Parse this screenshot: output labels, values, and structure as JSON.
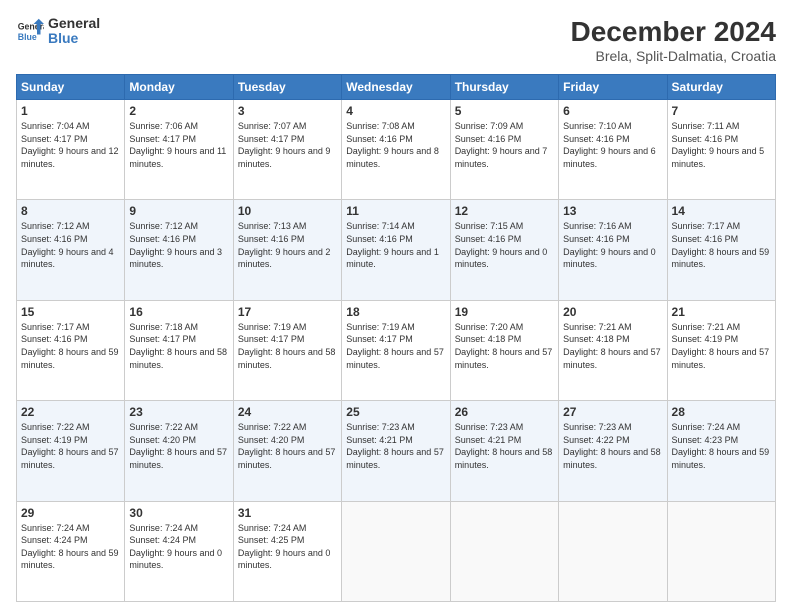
{
  "logo": {
    "line1": "General",
    "line2": "Blue"
  },
  "title": "December 2024",
  "subtitle": "Brela, Split-Dalmatia, Croatia",
  "days_header": [
    "Sunday",
    "Monday",
    "Tuesday",
    "Wednesday",
    "Thursday",
    "Friday",
    "Saturday"
  ],
  "weeks": [
    [
      {
        "day": "1",
        "sunrise": "7:04 AM",
        "sunset": "4:17 PM",
        "daylight": "9 hours and 12 minutes."
      },
      {
        "day": "2",
        "sunrise": "7:06 AM",
        "sunset": "4:17 PM",
        "daylight": "9 hours and 11 minutes."
      },
      {
        "day": "3",
        "sunrise": "7:07 AM",
        "sunset": "4:17 PM",
        "daylight": "9 hours and 9 minutes."
      },
      {
        "day": "4",
        "sunrise": "7:08 AM",
        "sunset": "4:16 PM",
        "daylight": "9 hours and 8 minutes."
      },
      {
        "day": "5",
        "sunrise": "7:09 AM",
        "sunset": "4:16 PM",
        "daylight": "9 hours and 7 minutes."
      },
      {
        "day": "6",
        "sunrise": "7:10 AM",
        "sunset": "4:16 PM",
        "daylight": "9 hours and 6 minutes."
      },
      {
        "day": "7",
        "sunrise": "7:11 AM",
        "sunset": "4:16 PM",
        "daylight": "9 hours and 5 minutes."
      }
    ],
    [
      {
        "day": "8",
        "sunrise": "7:12 AM",
        "sunset": "4:16 PM",
        "daylight": "9 hours and 4 minutes."
      },
      {
        "day": "9",
        "sunrise": "7:12 AM",
        "sunset": "4:16 PM",
        "daylight": "9 hours and 3 minutes."
      },
      {
        "day": "10",
        "sunrise": "7:13 AM",
        "sunset": "4:16 PM",
        "daylight": "9 hours and 2 minutes."
      },
      {
        "day": "11",
        "sunrise": "7:14 AM",
        "sunset": "4:16 PM",
        "daylight": "9 hours and 1 minute."
      },
      {
        "day": "12",
        "sunrise": "7:15 AM",
        "sunset": "4:16 PM",
        "daylight": "9 hours and 0 minutes."
      },
      {
        "day": "13",
        "sunrise": "7:16 AM",
        "sunset": "4:16 PM",
        "daylight": "9 hours and 0 minutes."
      },
      {
        "day": "14",
        "sunrise": "7:17 AM",
        "sunset": "4:16 PM",
        "daylight": "8 hours and 59 minutes."
      }
    ],
    [
      {
        "day": "15",
        "sunrise": "7:17 AM",
        "sunset": "4:16 PM",
        "daylight": "8 hours and 59 minutes."
      },
      {
        "day": "16",
        "sunrise": "7:18 AM",
        "sunset": "4:17 PM",
        "daylight": "8 hours and 58 minutes."
      },
      {
        "day": "17",
        "sunrise": "7:19 AM",
        "sunset": "4:17 PM",
        "daylight": "8 hours and 58 minutes."
      },
      {
        "day": "18",
        "sunrise": "7:19 AM",
        "sunset": "4:17 PM",
        "daylight": "8 hours and 57 minutes."
      },
      {
        "day": "19",
        "sunrise": "7:20 AM",
        "sunset": "4:18 PM",
        "daylight": "8 hours and 57 minutes."
      },
      {
        "day": "20",
        "sunrise": "7:21 AM",
        "sunset": "4:18 PM",
        "daylight": "8 hours and 57 minutes."
      },
      {
        "day": "21",
        "sunrise": "7:21 AM",
        "sunset": "4:19 PM",
        "daylight": "8 hours and 57 minutes."
      }
    ],
    [
      {
        "day": "22",
        "sunrise": "7:22 AM",
        "sunset": "4:19 PM",
        "daylight": "8 hours and 57 minutes."
      },
      {
        "day": "23",
        "sunrise": "7:22 AM",
        "sunset": "4:20 PM",
        "daylight": "8 hours and 57 minutes."
      },
      {
        "day": "24",
        "sunrise": "7:22 AM",
        "sunset": "4:20 PM",
        "daylight": "8 hours and 57 minutes."
      },
      {
        "day": "25",
        "sunrise": "7:23 AM",
        "sunset": "4:21 PM",
        "daylight": "8 hours and 57 minutes."
      },
      {
        "day": "26",
        "sunrise": "7:23 AM",
        "sunset": "4:21 PM",
        "daylight": "8 hours and 58 minutes."
      },
      {
        "day": "27",
        "sunrise": "7:23 AM",
        "sunset": "4:22 PM",
        "daylight": "8 hours and 58 minutes."
      },
      {
        "day": "28",
        "sunrise": "7:24 AM",
        "sunset": "4:23 PM",
        "daylight": "8 hours and 59 minutes."
      }
    ],
    [
      {
        "day": "29",
        "sunrise": "7:24 AM",
        "sunset": "4:24 PM",
        "daylight": "8 hours and 59 minutes."
      },
      {
        "day": "30",
        "sunrise": "7:24 AM",
        "sunset": "4:24 PM",
        "daylight": "9 hours and 0 minutes."
      },
      {
        "day": "31",
        "sunrise": "7:24 AM",
        "sunset": "4:25 PM",
        "daylight": "9 hours and 0 minutes."
      },
      null,
      null,
      null,
      null
    ]
  ],
  "labels": {
    "sunrise": "Sunrise: ",
    "sunset": "Sunset: ",
    "daylight": "Daylight: "
  }
}
